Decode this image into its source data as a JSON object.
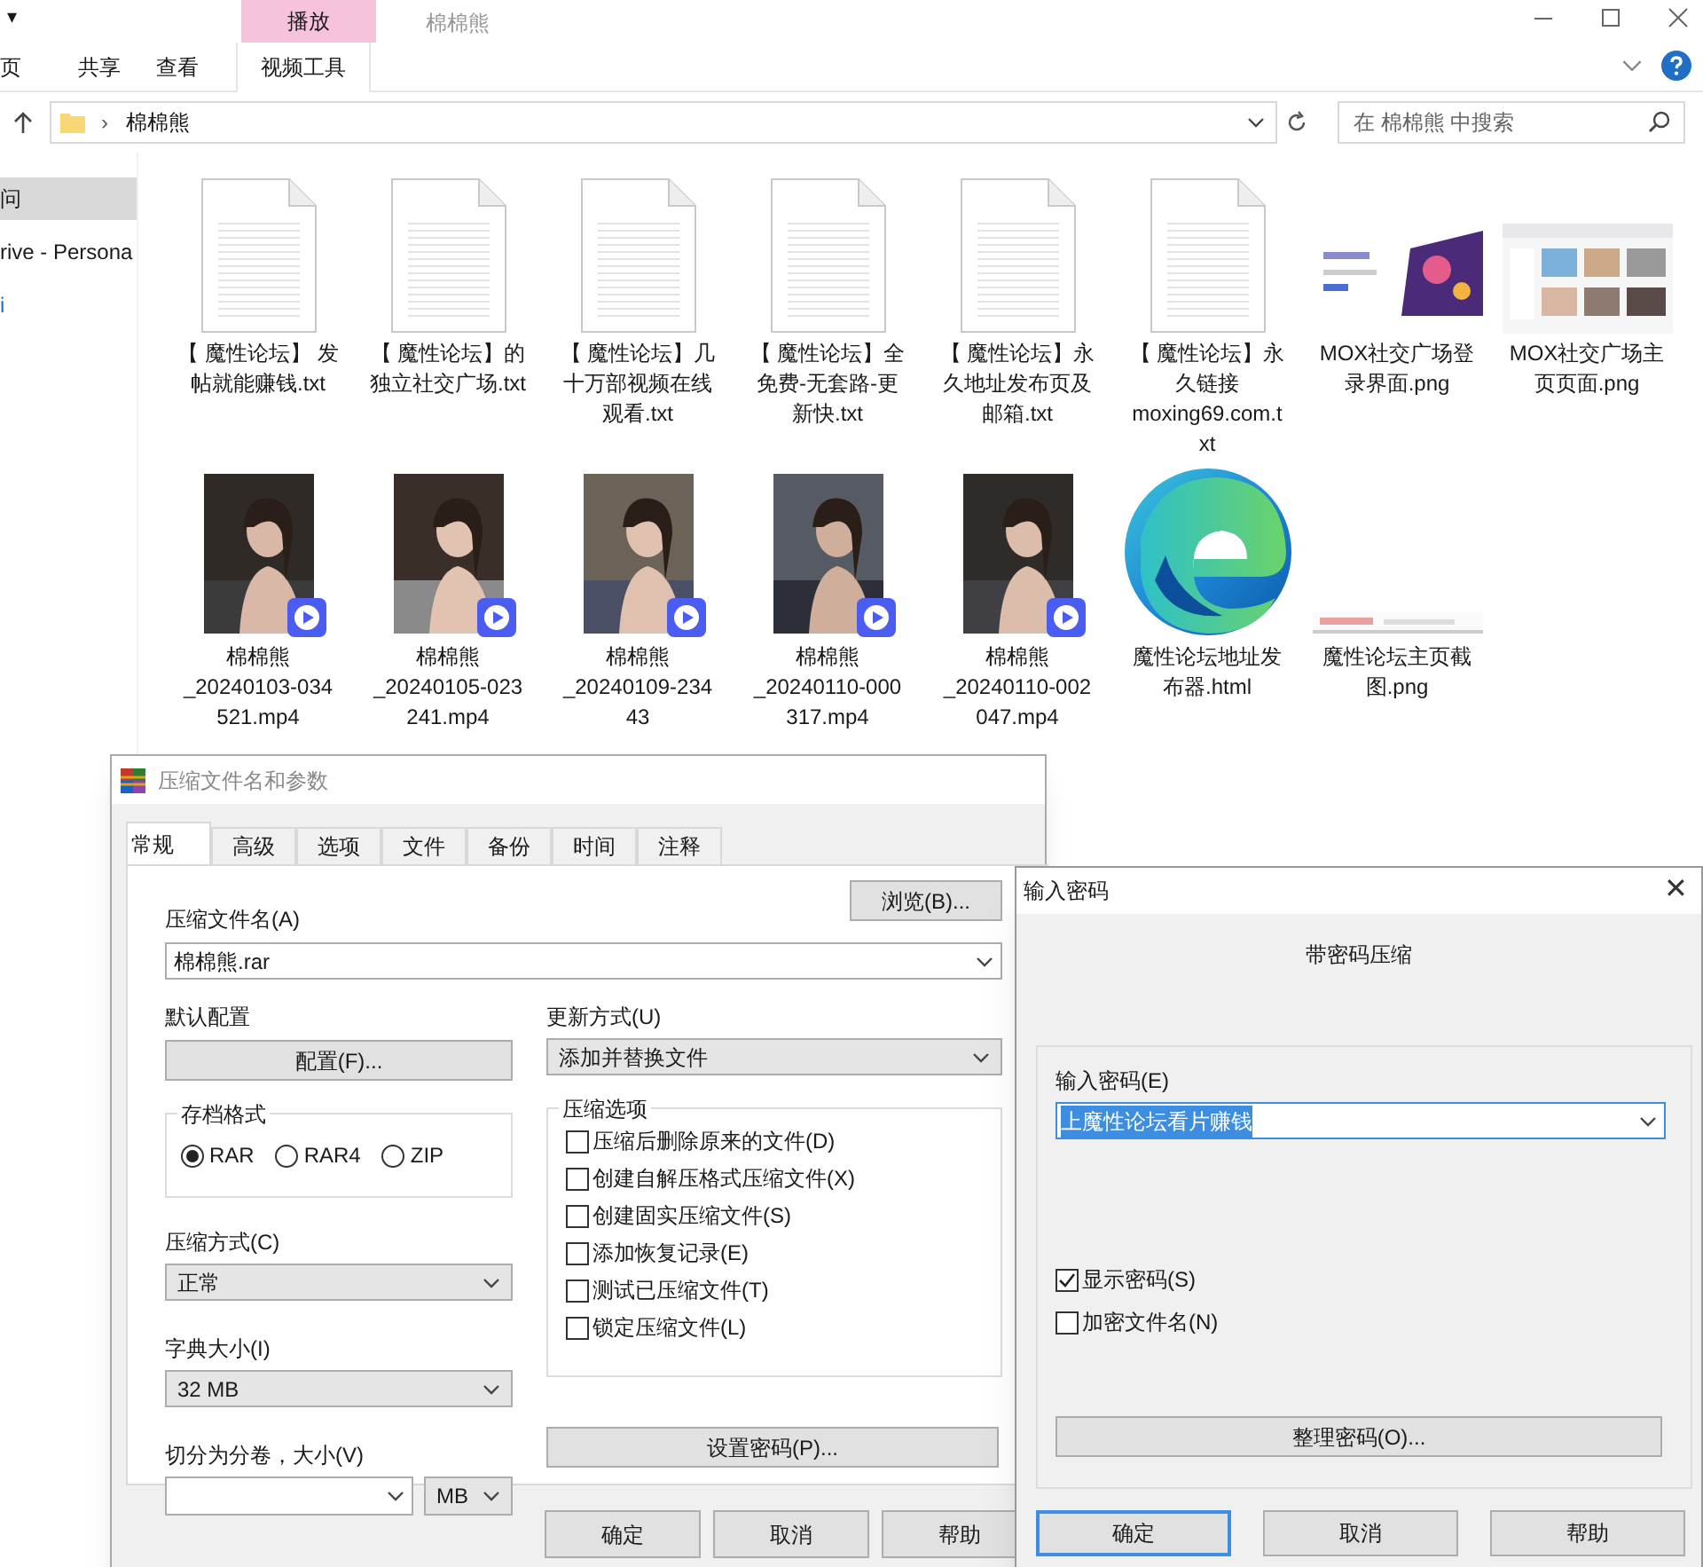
{
  "explorer": {
    "quick_access": "▾",
    "context_tab": {
      "header": "播放",
      "label": "视频工具"
    },
    "window_title": "棉棉熊",
    "ribbon_tabs": [
      {
        "label": "页",
        "selected": false
      },
      {
        "label": "共享",
        "selected": false
      },
      {
        "label": "查看",
        "selected": false
      }
    ],
    "address": {
      "separator": "›",
      "path": "棉棉熊"
    },
    "search": {
      "placeholder": "在 棉棉熊 中搜索"
    },
    "nav_items": [
      {
        "label": "问",
        "selected": true
      },
      {
        "label": "rive - Persona",
        "selected": false
      },
      {
        "label": "i",
        "selected": false
      }
    ],
    "files": [
      {
        "kind": "text",
        "lines": [
          "【 魔性论坛】 发",
          "帖就能赚钱.txt"
        ]
      },
      {
        "kind": "text",
        "lines": [
          "【 魔性论坛】的",
          "独立社交广场.txt"
        ]
      },
      {
        "kind": "text",
        "lines": [
          "【 魔性论坛】几",
          "十万部视频在线",
          "观看.txt"
        ]
      },
      {
        "kind": "text",
        "lines": [
          "【 魔性论坛】全",
          "免费-无套路-更",
          "新快.txt"
        ]
      },
      {
        "kind": "text",
        "lines": [
          "【 魔性论坛】永",
          "久地址发布页及",
          "邮箱.txt"
        ]
      },
      {
        "kind": "text",
        "lines": [
          "【 魔性论坛】永",
          "久链接",
          "moxing69.com.t",
          "xt"
        ]
      },
      {
        "lines": [
          "MOX社交广场登",
          "录界面.png"
        ]
      },
      {
        "lines": [
          "MOX社交广场主",
          "页页面.png"
        ]
      },
      {
        "kind": "video",
        "lines": [
          "棉棉熊",
          "_20240103-034",
          "521.mp4"
        ]
      },
      {
        "kind": "video",
        "lines": [
          "棉棉熊",
          "_20240105-023",
          "241.mp4"
        ]
      },
      {
        "kind": "video",
        "lines": [
          "棉棉熊",
          "_20240109-234",
          "43"
        ]
      },
      {
        "kind": "video",
        "lines": [
          "棉棉熊",
          "_20240110-000",
          "317.mp4"
        ]
      },
      {
        "kind": "video",
        "lines": [
          "棉棉熊",
          "_20240110-002",
          "047.mp4"
        ]
      },
      {
        "kind": "html",
        "lines": [
          "魔性论坛地址发",
          "布器.html"
        ]
      },
      {
        "lines": [
          "魔性论坛主页截",
          "图.png"
        ]
      }
    ]
  },
  "archive_dialog": {
    "title": "压缩文件名和参数",
    "tabs": [
      {
        "label": "常规",
        "selected": true
      },
      {
        "label": "高级",
        "selected": false
      },
      {
        "label": "选项",
        "selected": false
      },
      {
        "label": "文件",
        "selected": false
      },
      {
        "label": "备份",
        "selected": false
      },
      {
        "label": "时间",
        "selected": false
      },
      {
        "label": "注释",
        "selected": false
      }
    ],
    "archive_name": {
      "label": "压缩文件名(A)",
      "value": "棉棉熊.rar"
    },
    "browse_button": "浏览(B)...",
    "profile": {
      "label": "默认配置",
      "button": "配置(F)..."
    },
    "update_mode": {
      "label": "更新方式(U)",
      "value": "添加并替换文件"
    },
    "archive_format": {
      "label": "存档格式",
      "options": [
        {
          "label": "RAR",
          "selected": true
        },
        {
          "label": "RAR4",
          "selected": false
        },
        {
          "label": "ZIP",
          "selected": false
        }
      ]
    },
    "compression_method": {
      "label": "压缩方式(C)",
      "value": "正常"
    },
    "dictionary_size": {
      "label": "字典大小(I)",
      "value": "32 MB"
    },
    "split_volumes": {
      "label": "切分为分卷，大小(V)",
      "unit": "MB"
    },
    "archive_options": {
      "label": "压缩选项",
      "options": [
        {
          "label": "压缩后删除原来的文件(D)",
          "checked": false
        },
        {
          "label": "创建自解压格式压缩文件(X)",
          "checked": false
        },
        {
          "label": "创建固实压缩文件(S)",
          "checked": false
        },
        {
          "label": "添加恢复记录(E)",
          "checked": false
        },
        {
          "label": "测试已压缩文件(T)",
          "checked": false
        },
        {
          "label": "锁定压缩文件(L)",
          "checked": false
        }
      ]
    },
    "set_password_button": "设置密码(P)...",
    "buttons": [
      "确定",
      "取消",
      "帮助"
    ]
  },
  "password_dialog": {
    "title": "输入密码",
    "close": "✕",
    "heading": "带密码压缩",
    "password": {
      "label": "输入密码(E)",
      "value": "上魔性论坛看片赚钱",
      "selected": true
    },
    "checkboxes": [
      {
        "label": "显示密码(S)",
        "checked": true
      },
      {
        "label": "加密文件名(N)",
        "checked": false
      }
    ],
    "organize_button": "整理密码(O)...",
    "buttons": [
      {
        "label": "确定",
        "selected": true
      },
      {
        "label": "取消",
        "selected": false
      },
      {
        "label": "帮助",
        "selected": false
      }
    ]
  }
}
